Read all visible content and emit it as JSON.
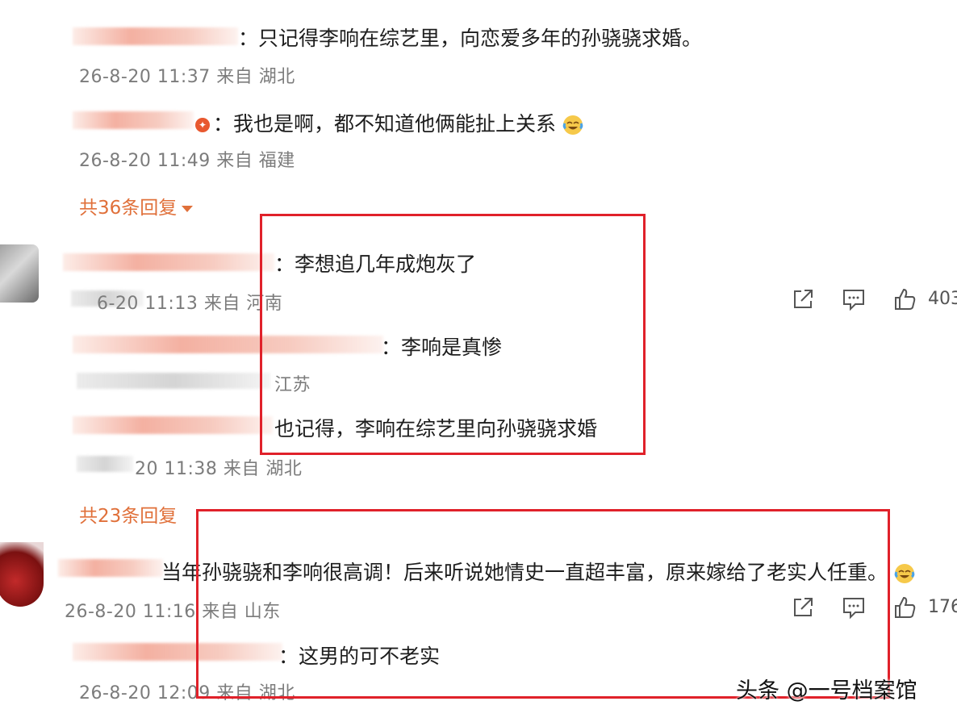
{
  "replies_top": [
    {
      "text": "：只记得李响在综艺里，向恋爱多年的孙骁骁求婚。",
      "date": "26-8-20 11:37",
      "location": "来自 湖北"
    },
    {
      "text": "我也是啊，都不知道他俩能扯上关系",
      "date": "26-8-20 11:49",
      "location": "来自 福建"
    }
  ],
  "more_replies_1": "共36条回复",
  "comment_1": {
    "text": "：李想追几年成炮灰了",
    "meta": "6-20 11:13 来自 河南",
    "likes": "403"
  },
  "replies_mid": [
    {
      "text": "：李响是真惨",
      "meta": "江苏"
    },
    {
      "text": "也记得，李响在综艺里向孙骁骁求婚",
      "meta": "20 11:38 来自 湖北"
    }
  ],
  "more_replies_2": "共23条回复",
  "comment_2": {
    "text": "当年孙骁骁和李响很高调！后来听说她情史一直超丰富，原来嫁给了老实人任重。",
    "meta": "26-8-20 11:16 来自 山东",
    "likes": "176"
  },
  "reply_last": {
    "text": "：这男的可不老实",
    "meta": "26-8-20 12:09 来自 湖北"
  },
  "watermark": "头条 @一号档案馆",
  "colors": {
    "highlight_box": "#e0212a",
    "link": "#e0703a"
  },
  "icons": [
    "share-icon",
    "comment-icon",
    "like-icon",
    "laugh-cry-emoji-icon",
    "verified-badge-icon"
  ]
}
